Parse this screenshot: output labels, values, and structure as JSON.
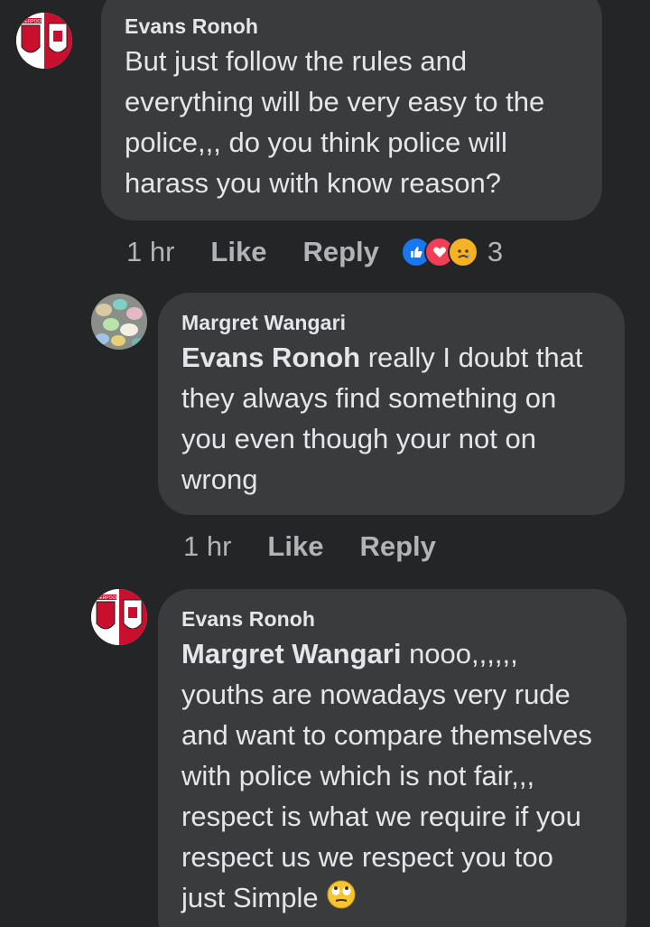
{
  "comments": [
    {
      "author": "Evans Ronoh",
      "mention": "",
      "text": "But just follow the rules and everything will be very easy to the police,,, do you think police will harass you with know reason?",
      "time": "1 hr",
      "like_label": "Like",
      "reply_label": "Reply",
      "reaction_icons": [
        "like-icon",
        "love-icon",
        "sad-icon"
      ],
      "reaction_count": "3",
      "avatar_icon": "liverpool-crest-avatar",
      "avatar_text": "LIVERPOOL"
    },
    {
      "author": "Margret Wangari",
      "mention": "Evans Ronoh",
      "text": " really I doubt that they always find something on you even though your not on wrong",
      "time": "1 hr",
      "like_label": "Like",
      "reply_label": "Reply",
      "avatar_icon": "colorful-pebbles-avatar"
    },
    {
      "author": "Evans Ronoh",
      "mention": "Margret Wangari",
      "text": " nooo,,,,,, youths are nowadays very rude and want to compare themselves with police which is not fair,,, respect is what we require if you respect us we respect you too just Simple",
      "trailing_emoji": "eye-roll-emoji-icon",
      "avatar_icon": "liverpool-crest-avatar",
      "avatar_text": "LIVERPOOL"
    }
  ],
  "colors": {
    "background": "#242526",
    "bubble": "#3a3b3c",
    "text": "#e4e6eb",
    "meta": "#b0b3b8",
    "like_blue": "#1877f2",
    "love_red": "#f33e58",
    "sad_yellow": "#f7b125"
  }
}
